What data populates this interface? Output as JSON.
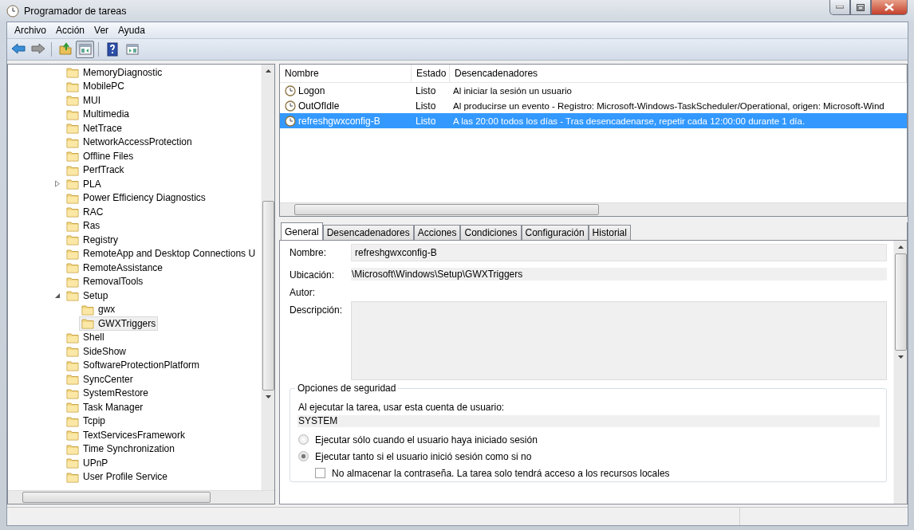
{
  "window": {
    "title": "Programador de tareas"
  },
  "menu": [
    "Archivo",
    "Acción",
    "Ver",
    "Ayuda"
  ],
  "toolbar": [
    {
      "kind": "back",
      "pressed": false
    },
    {
      "kind": "forward",
      "pressed": false
    },
    {
      "kind": "sep"
    },
    {
      "kind": "folder-up",
      "pressed": false
    },
    {
      "kind": "tree-pane",
      "pressed": true
    },
    {
      "kind": "sep"
    },
    {
      "kind": "help",
      "pressed": false
    },
    {
      "kind": "action-pane",
      "pressed": false
    }
  ],
  "tree": [
    {
      "label": "MemoryDiagnostic",
      "selected": false
    },
    {
      "label": "MobilePC",
      "selected": false
    },
    {
      "label": "MUI",
      "selected": false
    },
    {
      "label": "Multimedia",
      "selected": false
    },
    {
      "label": "NetTrace",
      "selected": false
    },
    {
      "label": "NetworkAccessProtection",
      "selected": false
    },
    {
      "label": "Offline Files",
      "selected": false
    },
    {
      "label": "PerfTrack",
      "selected": false
    },
    {
      "label": "PLA",
      "selected": false,
      "expanded": false
    },
    {
      "label": "Power Efficiency Diagnostics",
      "selected": false
    },
    {
      "label": "RAC",
      "selected": false
    },
    {
      "label": "Ras",
      "selected": false
    },
    {
      "label": "Registry",
      "selected": false
    },
    {
      "label": "RemoteApp and Desktop Connections U",
      "selected": false
    },
    {
      "label": "RemoteAssistance",
      "selected": false
    },
    {
      "label": "RemovalTools",
      "selected": false
    },
    {
      "label": "Setup",
      "selected": false,
      "expanded": true,
      "children": [
        {
          "label": "gwx",
          "selected": false
        },
        {
          "label": "GWXTriggers",
          "selected": true
        }
      ]
    },
    {
      "label": "Shell",
      "selected": false
    },
    {
      "label": "SideShow",
      "selected": false
    },
    {
      "label": "SoftwareProtectionPlatform",
      "selected": false
    },
    {
      "label": "SyncCenter",
      "selected": false
    },
    {
      "label": "SystemRestore",
      "selected": false
    },
    {
      "label": "Task Manager",
      "selected": false
    },
    {
      "label": "Tcpip",
      "selected": false
    },
    {
      "label": "TextServicesFramework",
      "selected": false
    },
    {
      "label": "Time Synchronization",
      "selected": false
    },
    {
      "label": "UPnP",
      "selected": false
    },
    {
      "label": "User Profile Service",
      "selected": false
    }
  ],
  "tasks": {
    "columns": [
      "Nombre",
      "Estado",
      "Desencadenadores"
    ],
    "rows": [
      {
        "name": "Logon",
        "status": "Listo",
        "triggers": "Al iniciar la sesión un usuario",
        "selected": false
      },
      {
        "name": "OutOfIdle",
        "status": "Listo",
        "triggers": "Al producirse un evento - Registro: Microsoft-Windows-TaskScheduler/Operational, origen: Microsoft-Wind",
        "selected": false
      },
      {
        "name": "refreshgwxconfig-B",
        "status": "Listo",
        "triggers": "A las 20:00 todos los días - Tras desencadenarse, repetir cada 12:00:00 durante 1 día.",
        "selected": true
      }
    ]
  },
  "details": {
    "tabs": [
      {
        "label": "General",
        "selected": true
      },
      {
        "label": "Desencadenadores",
        "selected": false
      },
      {
        "label": "Acciones",
        "selected": false
      },
      {
        "label": "Condiciones",
        "selected": false
      },
      {
        "label": "Configuración",
        "selected": false
      },
      {
        "label": "Historial",
        "selected": false
      }
    ],
    "fields": [
      {
        "label": "Nombre:",
        "kind": "box",
        "value": "refreshgwxconfig-B"
      },
      {
        "label": "Ubicación:",
        "kind": "flat",
        "value": "\\Microsoft\\Windows\\Setup\\GWXTriggers"
      },
      {
        "label": "Autor:",
        "kind": "none"
      },
      {
        "label": "Descripción:",
        "kind": "area"
      }
    ],
    "security": {
      "title": "Opciones de seguridad",
      "account_label": "Al ejecutar la tarea, usar esta cuenta de usuario:",
      "account": "SYSTEM",
      "options": [
        {
          "kind": "radio",
          "label": "Ejecutar sólo cuando el usuario haya iniciado sesión",
          "selected": false
        },
        {
          "kind": "radio",
          "label": "Ejecutar tanto si el usuario inició sesión como si no",
          "selected": true
        },
        {
          "kind": "checkbox",
          "label": "No almacenar la contraseña. La tarea solo tendrá acceso a los recursos locales",
          "checked": false
        }
      ]
    }
  }
}
